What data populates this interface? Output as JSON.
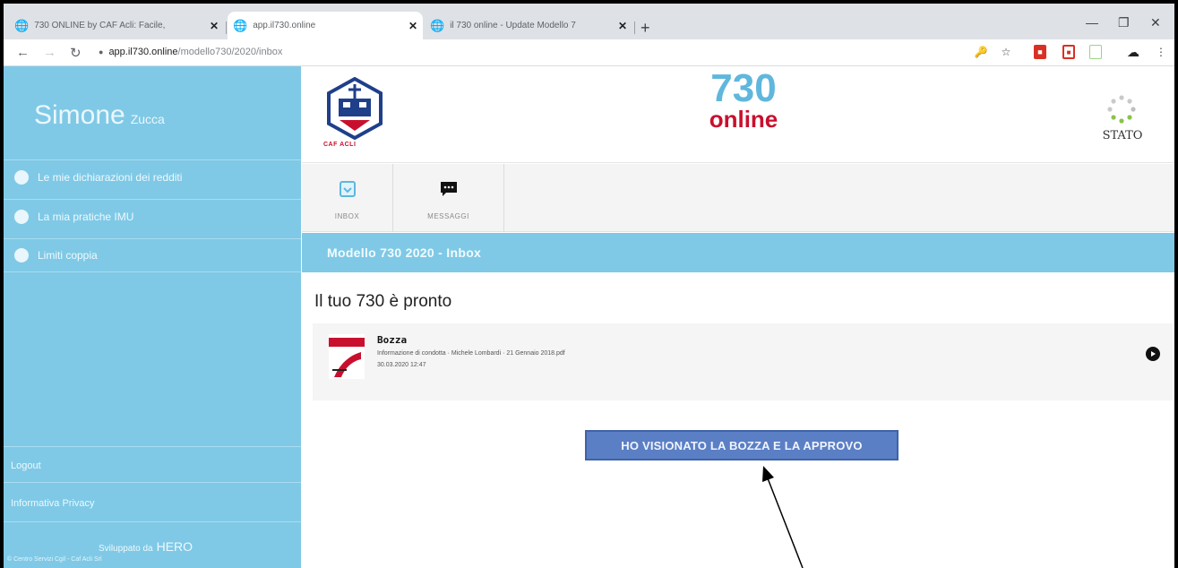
{
  "browser": {
    "tabs": [
      {
        "title": "730 ONLINE by CAF Acli: Facile,",
        "active": false
      },
      {
        "title": "app.il730.online",
        "active": true
      },
      {
        "title": "il 730 online - Update Modello 7",
        "active": false
      }
    ],
    "new_tab": "+",
    "url_domain": "app.il730.online",
    "url_path": "/modello730/2020/inbox"
  },
  "sidebar": {
    "first_name": "Simone",
    "last_name": "Zucca",
    "items": [
      {
        "label": "Le mie dichiarazioni dei redditi"
      },
      {
        "label": "La mia pratiche IMU"
      },
      {
        "label": "Limiti coppia"
      }
    ],
    "logout": "Logout",
    "privacy": "Informativa Privacy",
    "developed_by": "Sviluppato da",
    "developer": "HERO",
    "copyright": "© Centro Servizi Cgil - Caf Acli Srl"
  },
  "header": {
    "logo_caption": "CAF ACLI",
    "brand_number": "730",
    "brand_word": "online",
    "status_label": "STATO"
  },
  "nav_tabs": [
    {
      "label": "INBOX"
    },
    {
      "label": "MESSAGGI"
    }
  ],
  "section_title": "Modello 730 2020 - Inbox",
  "content": {
    "heading": "Il tuo 730 è pronto",
    "document": {
      "name": "Bozza",
      "description": "Informazione di condotta · Michele Lombardi · 21 Gennaio 2018.pdf",
      "date": "30.03.2020 12:47"
    },
    "approve_button": "HO VISIONATO LA BOZZA E LA APPROVO"
  },
  "colors": {
    "sidebar": "#7fc9e6",
    "brand_blue": "#5fb7dd",
    "brand_red": "#c8102e",
    "button": "#5b7fc4"
  }
}
